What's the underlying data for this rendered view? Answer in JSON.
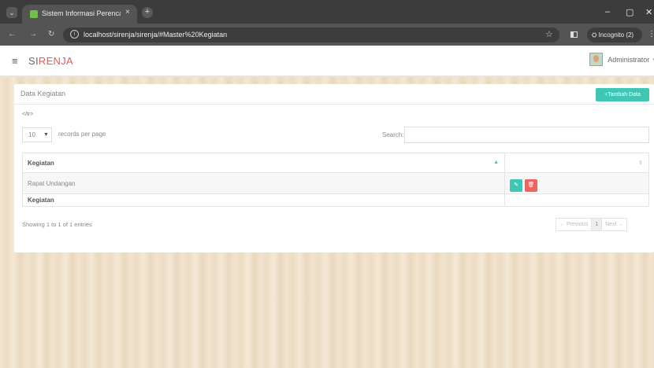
{
  "browser": {
    "tab_title": "Sistem Informasi Perencanaan",
    "tab_close": "×",
    "new_tab": "+",
    "url": "localhost/sirenja/sirenja/#Master%20Kegiatan",
    "incognito_label": "Incognito (2)",
    "menu_glyph": "⌄",
    "minimize": "–",
    "restore": "▢",
    "close": "✕",
    "back": "←",
    "forward": "→",
    "reload": "↻",
    "info_glyph": "i",
    "star": "☆",
    "more": "⋮"
  },
  "header": {
    "menu_glyph": "≡",
    "logo_si": "SI",
    "logo_renja": "RENJA",
    "user_name": "Administrator",
    "caret": "▾"
  },
  "card": {
    "title": "Data Kegiatan",
    "add_button": "+Tambah Data",
    "stray_text": "</tr>",
    "length_value": "10",
    "length_label": "records per page",
    "search_label": "Search:",
    "search_value": "",
    "columns": [
      "Kegiatan",
      ""
    ],
    "rows": [
      {
        "kegiatan": "Rapat Undangan"
      }
    ],
    "footer_columns": [
      "Kegiatan",
      ""
    ],
    "info": "Showing 1 to 1 of 1 entries",
    "pager": {
      "previous": "← Previous",
      "current": "1",
      "next": "Next →"
    }
  },
  "colors": {
    "accent": "#3fc6b5",
    "danger": "#f0645f",
    "logo_red": "#e05c5c"
  }
}
